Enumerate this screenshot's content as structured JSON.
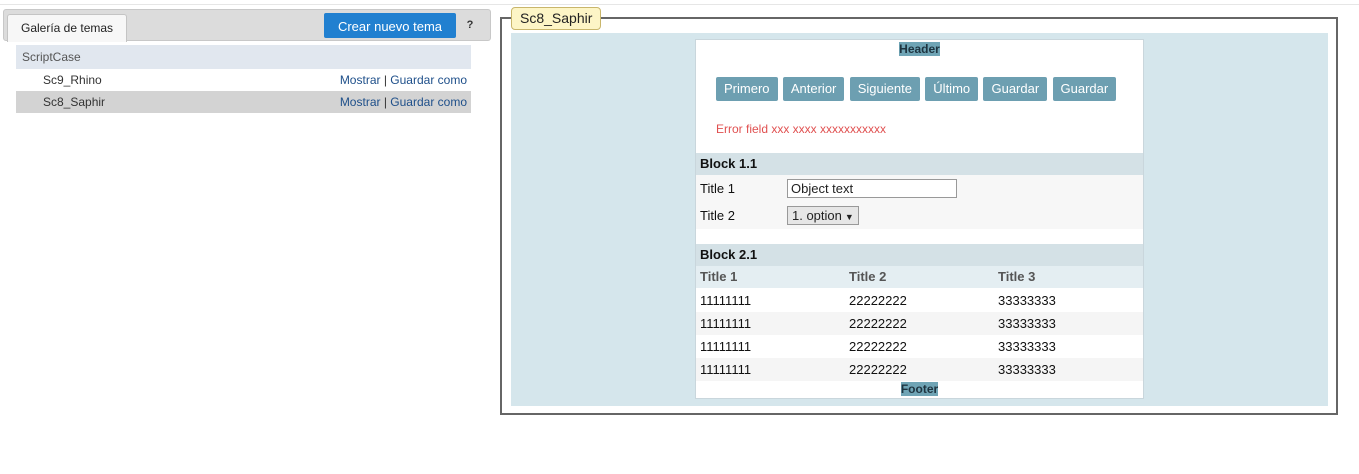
{
  "tabs": {
    "gallery": "Galería de temas"
  },
  "actions": {
    "create_theme": "Crear nuevo tema",
    "help": "?"
  },
  "theme_list": {
    "group": "ScriptCase",
    "show_label": "Mostrar",
    "separator": "|",
    "save_as_label": "Guardar como",
    "themes": [
      {
        "name": "Sc9_Rhino",
        "selected": false
      },
      {
        "name": "Sc8_Saphir",
        "selected": true
      }
    ]
  },
  "preview": {
    "legend": "Sc8_Saphir",
    "header": "Header",
    "toolbar": [
      "Primero",
      "Anterior",
      "Siguiente",
      "Último",
      "Guardar",
      "Guardar"
    ],
    "error": "Error field xxx xxxx xxxxxxxxxxx",
    "block1": {
      "title": "Block 1.1",
      "field1_label": "Title 1",
      "field1_value": "Object text",
      "field2_label": "Title 2",
      "field2_value": "1. option"
    },
    "block2": {
      "title": "Block 2.1",
      "columns": [
        "Title 1",
        "Title 2",
        "Title 3"
      ],
      "rows": [
        [
          "11111111",
          "22222222",
          "33333333"
        ],
        [
          "11111111",
          "22222222",
          "33333333"
        ],
        [
          "11111111",
          "22222222",
          "33333333"
        ],
        [
          "11111111",
          "22222222",
          "33333333"
        ]
      ]
    },
    "footer": "Footer"
  },
  "colors": {
    "accent": "#2180d0",
    "button": "#6d9fb1",
    "error": "#e05050",
    "preview_bg": "#d5e6ec",
    "legend_bg": "#fdf5c6"
  }
}
